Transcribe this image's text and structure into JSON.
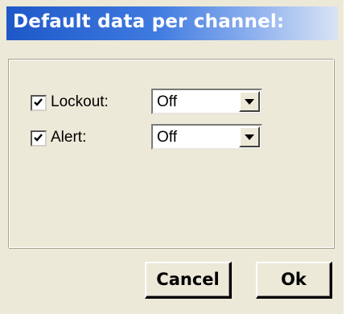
{
  "dialog": {
    "title": "Default data per channel:",
    "rows": [
      {
        "label": "Lockout:",
        "checked": true,
        "value": "Off"
      },
      {
        "label": "Alert:",
        "checked": true,
        "value": "Off"
      }
    ],
    "cancel_label": "Cancel",
    "ok_label": "Ok"
  },
  "icons": {
    "dropdown": "chevron-down-icon",
    "check": "check-icon"
  },
  "colors": {
    "title_bar": "#1e58c8",
    "dialog_background": "#ece9d8"
  }
}
